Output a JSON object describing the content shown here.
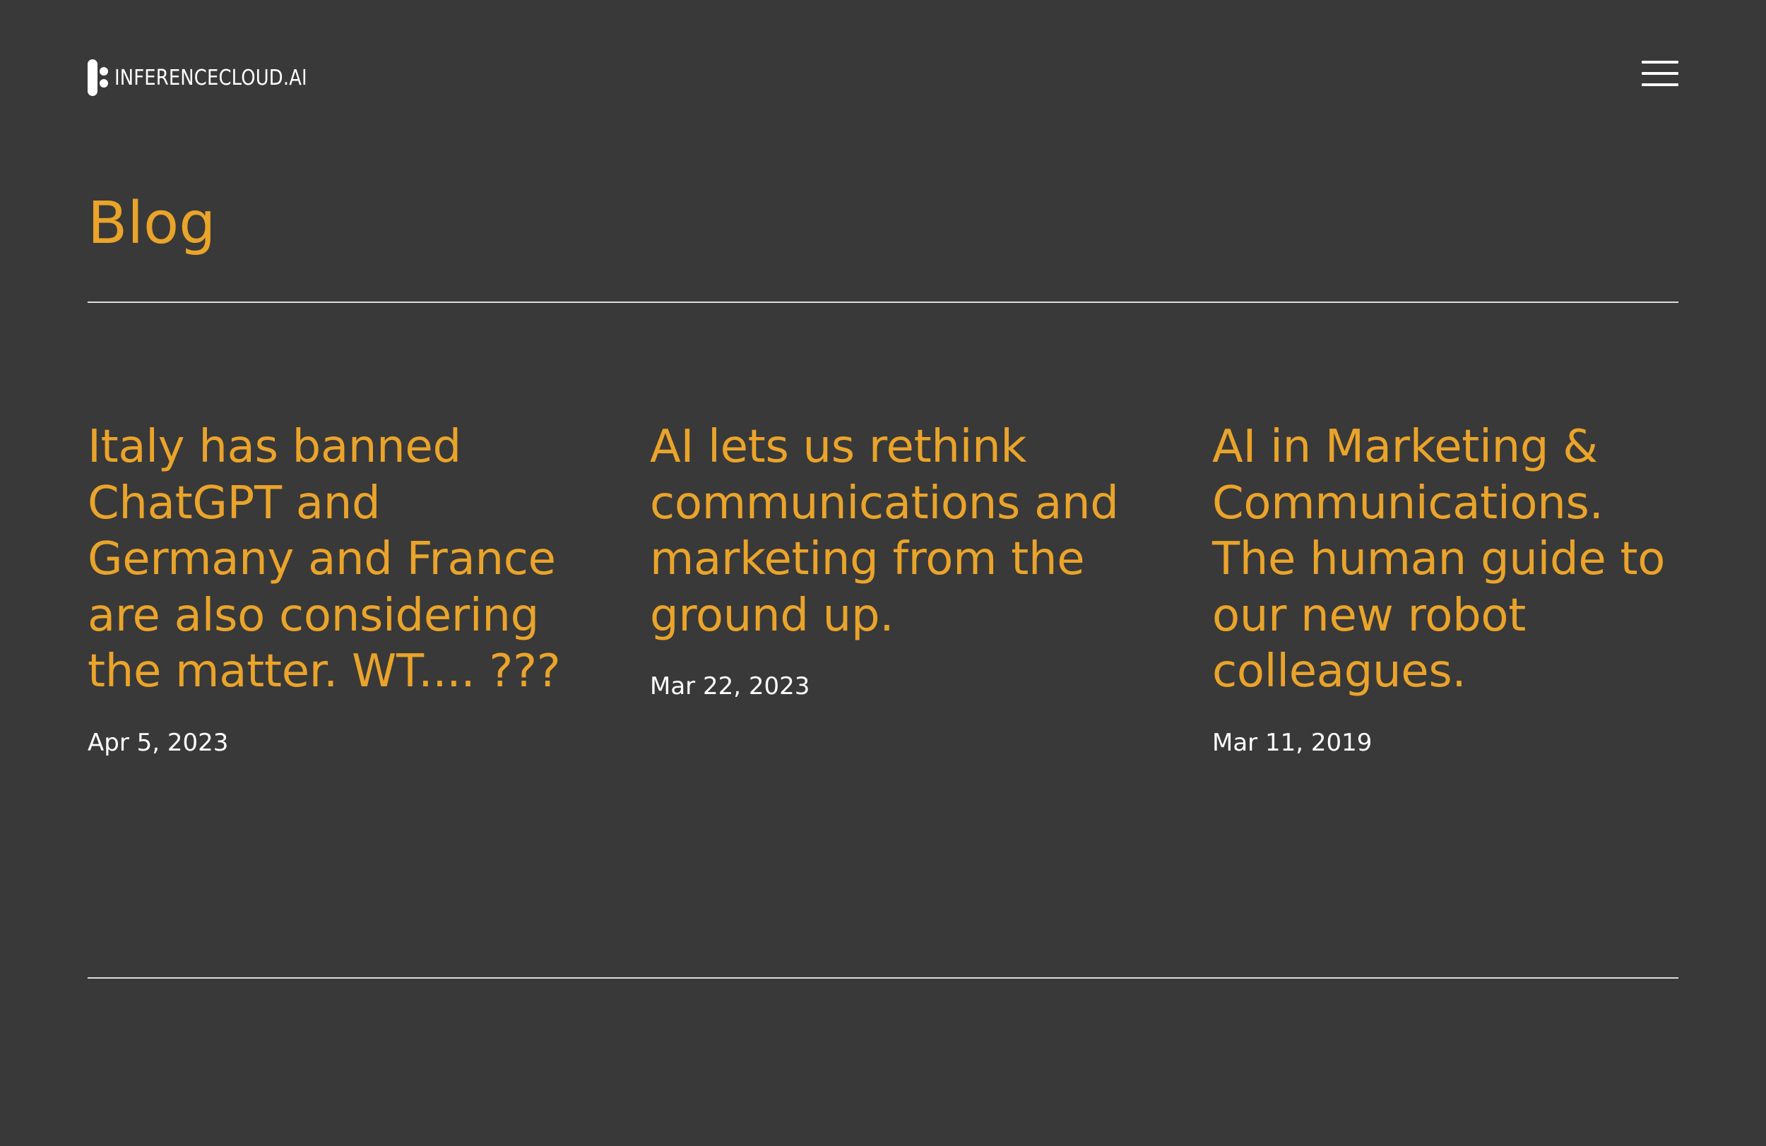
{
  "header": {
    "logo_text": "INFERENCECLOUD.AI",
    "menu_icon": "hamburger-menu-icon"
  },
  "page": {
    "title": "Blog"
  },
  "posts": [
    {
      "title": "Italy has banned ChatGPT and Germany and France are also considering the matter. WT.... ???",
      "date": "Apr 5, 2023"
    },
    {
      "title": "AI lets us rethink communications and marketing from the ground up.",
      "date": "Mar 22, 2023"
    },
    {
      "title": "AI in Marketing & Communications. The human guide to our new robot colleagues.",
      "date": "Mar 11, 2019"
    }
  ],
  "colors": {
    "background": "#393939",
    "accent": "#eaa42a",
    "text": "#ffffff",
    "divider": "#dcdcdc"
  }
}
